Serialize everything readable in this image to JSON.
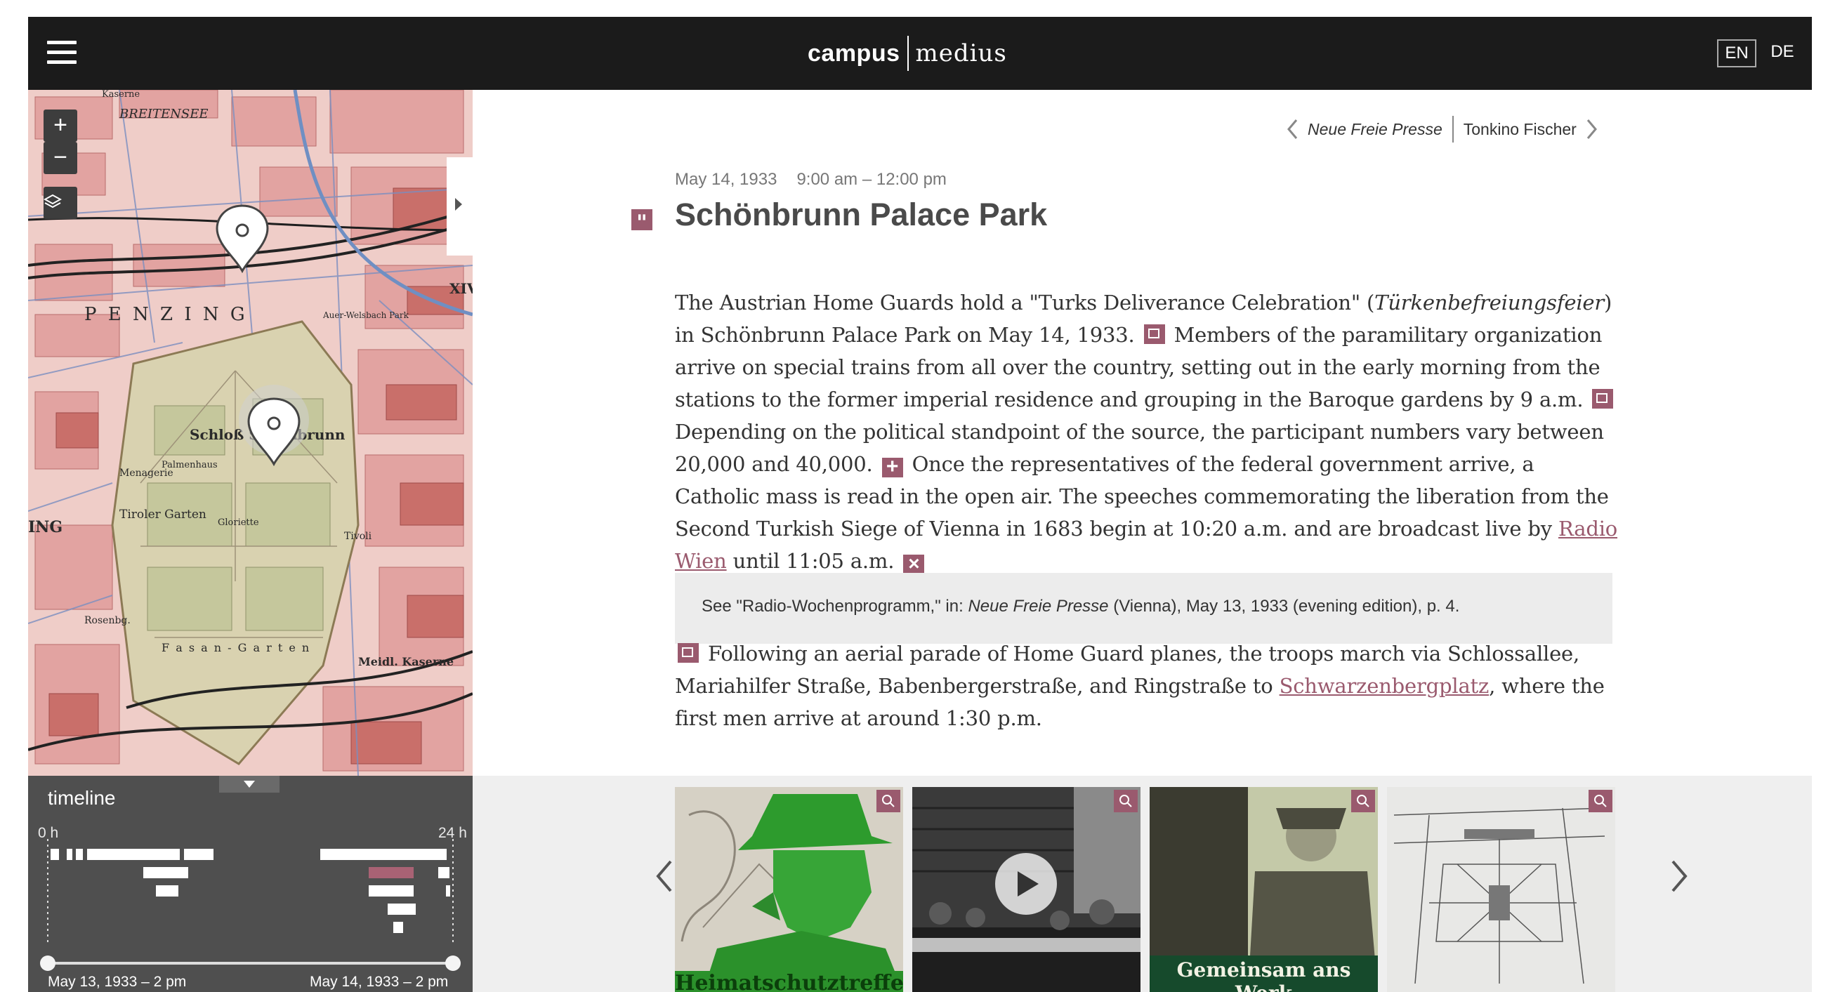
{
  "header": {
    "logo_left": "campus",
    "logo_right": "medius",
    "languages": [
      "EN",
      "DE"
    ],
    "active_language": "EN"
  },
  "map": {
    "zoom_in": "+",
    "zoom_out": "−",
    "labels": {
      "breitensee": "BREITENSEE",
      "penzing": "P E N Z I N G",
      "schloss": "Schloß Schönbrunn",
      "xiv": "XIV",
      "menagerie": "Menagerie",
      "tiroler_garten": "Tiroler Garten",
      "fasan_garten": "F a s a n - G a r t e n",
      "meidl_kaserne": "Meidl. Kaserne",
      "tivoli": "Tivoli",
      "gloriette": "Gloriette",
      "auer_welsbach_park": "Auer-Welsbach Park",
      "rosenberg": "Rosenbg.",
      "ing": "ING",
      "kaserne": "Kaserne",
      "palmenhaus": "Palmenhaus"
    }
  },
  "timeline": {
    "title": "timeline",
    "axis_start": "0 h",
    "axis_end": "24 h",
    "range_start": "May 13, 1933 – 2 pm",
    "range_end": "May 14, 1933 – 2 pm"
  },
  "article": {
    "prev_label": "Neue Freie Presse",
    "next_label": "Tonkino Fischer",
    "date": "May 14, 1933",
    "time": "9:00 am – 12:00 pm",
    "title": "Schönbrunn Palace Park",
    "p1_a": "The Austrian Home Guards hold a \"Turks Deliverance Celebration\" (",
    "p1_em": "Türkenbefreiungsfeier",
    "p1_b": ") in Schönbrunn Palace Park on May 14, 1933.",
    "p1_c": "Members of the paramilitary organization arrive on special trains from all over the country, setting out in the early morning from the stations to the former imperial residence and grouping in the Baroque gardens by 9 a.m.",
    "p1_d": "Depending on the political standpoint of the source, the participant numbers vary between 20,000 and 40,000.",
    "p1_e": "Once the representatives of the federal government arrive, a Catholic mass is read in the open air. The speeches commemorating the liberation from the Second Turkish Siege of Vienna in 1683 begin at 10:20 a.m. and are broadcast live by",
    "p1_link": "Radio Wien",
    "p1_f": "until 11:05 a.m.",
    "expand_symbol": "+",
    "close_symbol": "×",
    "note_a": "See \"Radio-Wochenprogramm,\" in: ",
    "note_em": "Neue Freie Presse",
    "note_b": " (Vienna), May 13, 1933 (evening edition), p. 4.",
    "p2_a": "Following an aerial parade of Home Guard planes, the troops march via Schlossallee, Mariahilfer Straße, Babenbergerstraße, and Ringstraße to",
    "p2_link": "Schwarzenbergplatz",
    "p2_b": ", where the first men arrive at around 1:30 p.m."
  },
  "gallery": {
    "poster1_text": "Heimatschutztreffen",
    "poster3_text": "Gemeinsam ans Werk"
  },
  "colors": {
    "accent": "#9a5a6e",
    "topbar": "#1b1b1b",
    "timeline_bg": "#4f4f4f"
  }
}
